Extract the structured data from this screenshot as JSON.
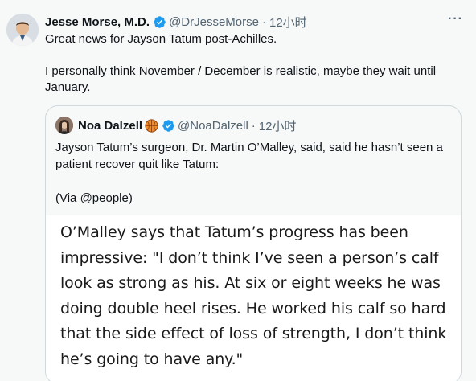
{
  "tweet": {
    "author_name": "Jesse Morse, M.D.",
    "author_handle": "@DrJesseMorse",
    "time": "12小时",
    "separator": "·",
    "more": "···",
    "text_line1": "Great news for Jayson Tatum post-Achilles.",
    "text_line2": "I personally think November / December is realistic, maybe they wait until January."
  },
  "quote": {
    "author_name": "Noa Dalzell",
    "author_handle": "@NoaDalzell",
    "time": "12小时",
    "separator": "·",
    "text_line1": "Jayson Tatum’s surgeon, Dr. Martin O’Malley, said, said he hasn’t seen a patient recover quit like Tatum:",
    "text_line2": "(Via @people)",
    "image_text": "O’Malley says that Tatum’s progress has been impressive: \"I don’t think I’ve seen a person’s calf look as strong as his. At six or eight weeks he was doing double heel rises. He worked his calf so hard that the side effect of loss of strength, I don’t think he’s going to have any.\""
  },
  "colors": {
    "verified": "#1d9bf0",
    "secondary_text": "#536471",
    "border": "#cfd9de",
    "background": "#f7f8f8"
  },
  "icons": {
    "verified": "verified-badge-icon",
    "basketball": "basketball-emoji-icon",
    "more": "more-options-icon"
  }
}
